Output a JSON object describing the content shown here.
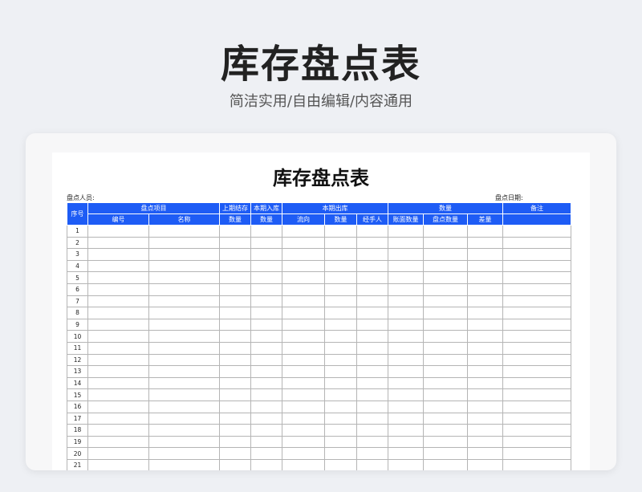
{
  "hero": {
    "title": "库存盘点表",
    "subtitle": "简洁实用/自由编辑/内容通用"
  },
  "sheet": {
    "title": "库存盘点表",
    "inspector_label": "盘点人员:",
    "date_label": "盘点日期:"
  },
  "table": {
    "header_group": {
      "seq": "序号",
      "check_items": "盘点项目",
      "prev_stock": "上期结存",
      "cur_in": "本期入库",
      "cur_out": "本期出库",
      "quantity": "数量",
      "remark": "备注"
    },
    "header_sub": {
      "code": "编号",
      "name": "名称",
      "prev_qty": "数量",
      "in_qty": "数量",
      "direction": "流向",
      "out_qty": "数量",
      "handler": "经手人",
      "book_qty": "账面数量",
      "check_qty": "盘点数量",
      "diff": "差量"
    },
    "row_numbers": [
      "1",
      "2",
      "3",
      "4",
      "5",
      "6",
      "7",
      "8",
      "9",
      "10",
      "11",
      "12",
      "13",
      "14",
      "15",
      "16",
      "17",
      "18",
      "19",
      "20",
      "21"
    ]
  },
  "colors": {
    "header_blue": "#1e5cf5",
    "grid_gray": "#b5b5b5"
  }
}
